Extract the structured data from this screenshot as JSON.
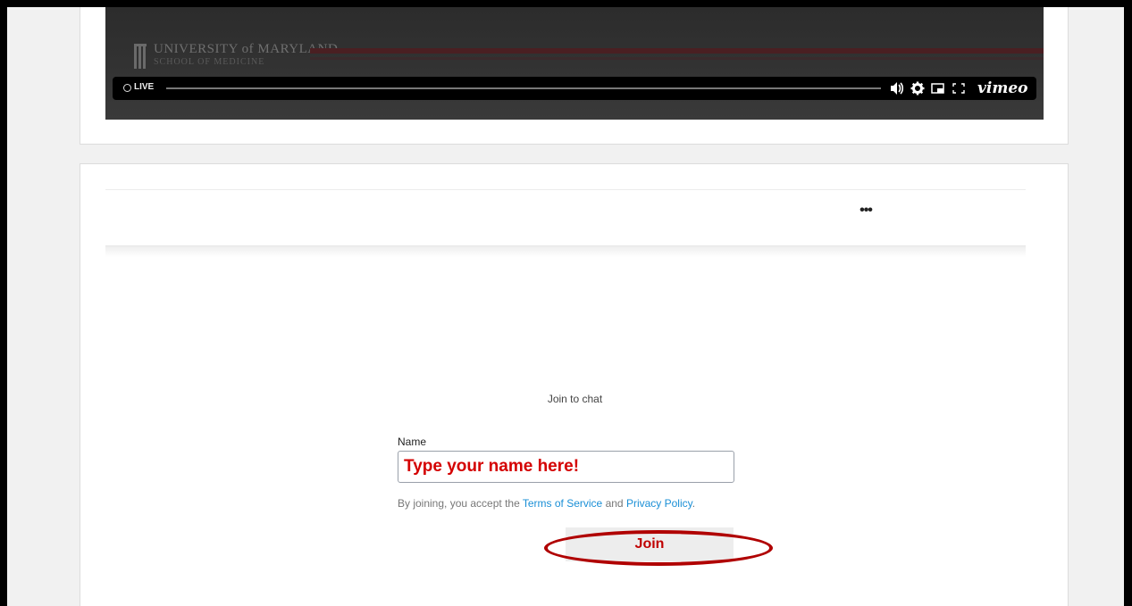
{
  "video": {
    "brand_name": "UNIVERSITY of MARYLAND",
    "brand_sub": "SCHOOL OF MEDICINE",
    "live_label": "LIVE",
    "provider": "vimeo",
    "icons": {
      "volume": "volume-icon",
      "settings": "gear-icon",
      "pip": "picture-in-picture-icon",
      "fullscreen": "fullscreen-icon"
    }
  },
  "chat": {
    "more_label": "•••",
    "join_title": "Join to chat",
    "name_label": "Name",
    "name_placeholder": "Type your name here!",
    "legal_prefix": "By joining, you accept the ",
    "terms_label": "Terms of Service",
    "legal_and": " and ",
    "privacy_label": "Privacy Policy",
    "legal_suffix": ".",
    "join_button": "Join"
  },
  "colors": {
    "accent_link": "#1a8fd6",
    "annotation_red": "#b00000"
  }
}
